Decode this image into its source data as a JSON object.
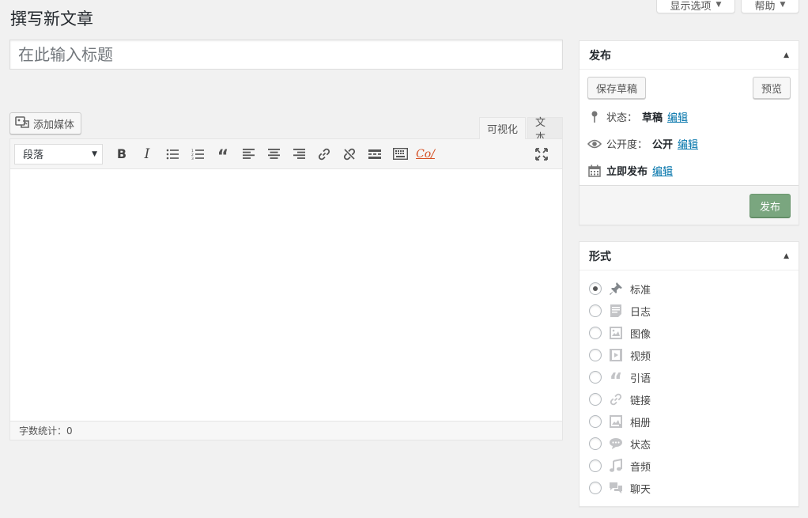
{
  "screen_tabs": {
    "screen_options": "显示选项",
    "help": "帮助"
  },
  "page": {
    "title": "撰写新文章"
  },
  "post_title": {
    "placeholder": "在此输入标题",
    "value": ""
  },
  "media": {
    "add_media_label": "添加媒体"
  },
  "editor": {
    "tabs": [
      {
        "label": "可视化",
        "active": true
      },
      {
        "label": "文本",
        "active": false
      }
    ],
    "format_select": "段落",
    "toolbar_icons": [
      "bold-icon",
      "italic-icon",
      "bulleted-list-icon",
      "numbered-list-icon",
      "blockquote-icon",
      "align-left-icon",
      "align-center-icon",
      "align-right-icon",
      "link-icon",
      "unlink-icon",
      "read-more-icon",
      "toolbar-toggle-icon",
      "cos-icon",
      "fullscreen-icon"
    ],
    "word_count": "字数统计：0"
  },
  "publish": {
    "title": "发布",
    "save_draft": "保存草稿",
    "preview": "预览",
    "status_label": "状态：",
    "status_value": "草稿",
    "visibility_label": "公开度：",
    "visibility_value": "公开",
    "schedule_value": "立即发布",
    "edit": "编辑",
    "publish_button": "发布",
    "publish_color": "#7aa67f"
  },
  "format": {
    "title": "形式",
    "options": [
      {
        "label": "标准",
        "icon": "pin-icon",
        "checked": true
      },
      {
        "label": "日志",
        "icon": "aside-icon",
        "checked": false
      },
      {
        "label": "图像",
        "icon": "image-icon",
        "checked": false
      },
      {
        "label": "视频",
        "icon": "video-icon",
        "checked": false
      },
      {
        "label": "引语",
        "icon": "quote-icon",
        "checked": false
      },
      {
        "label": "链接",
        "icon": "link-icon",
        "checked": false
      },
      {
        "label": "相册",
        "icon": "gallery-icon",
        "checked": false
      },
      {
        "label": "状态",
        "icon": "status-icon",
        "checked": false
      },
      {
        "label": "音频",
        "icon": "audio-icon",
        "checked": false
      },
      {
        "label": "聊天",
        "icon": "chat-icon",
        "checked": false
      }
    ]
  }
}
